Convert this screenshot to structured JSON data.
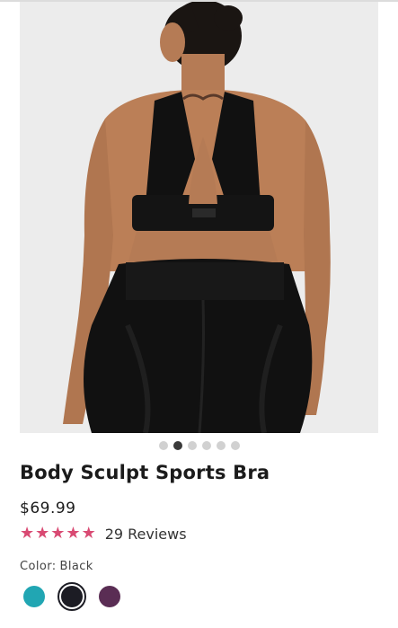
{
  "product": {
    "title": "Body Sculpt Sports Bra",
    "price": "$69.99",
    "rating": {
      "stars": 5,
      "reviews_label": "29 Reviews"
    },
    "color": {
      "label": "Color:",
      "selected": "Black",
      "swatches": [
        {
          "name": "teal",
          "hex": "#21a6b3"
        },
        {
          "name": "black",
          "hex": "#1c1c24"
        },
        {
          "name": "plum",
          "hex": "#5a2d54"
        }
      ]
    }
  },
  "gallery": {
    "image_count": 6,
    "active_index": 1
  },
  "colors": {
    "star": "#d94a73",
    "dot_active": "#3a3a3a",
    "dot_inactive": "#d1d1d1"
  }
}
